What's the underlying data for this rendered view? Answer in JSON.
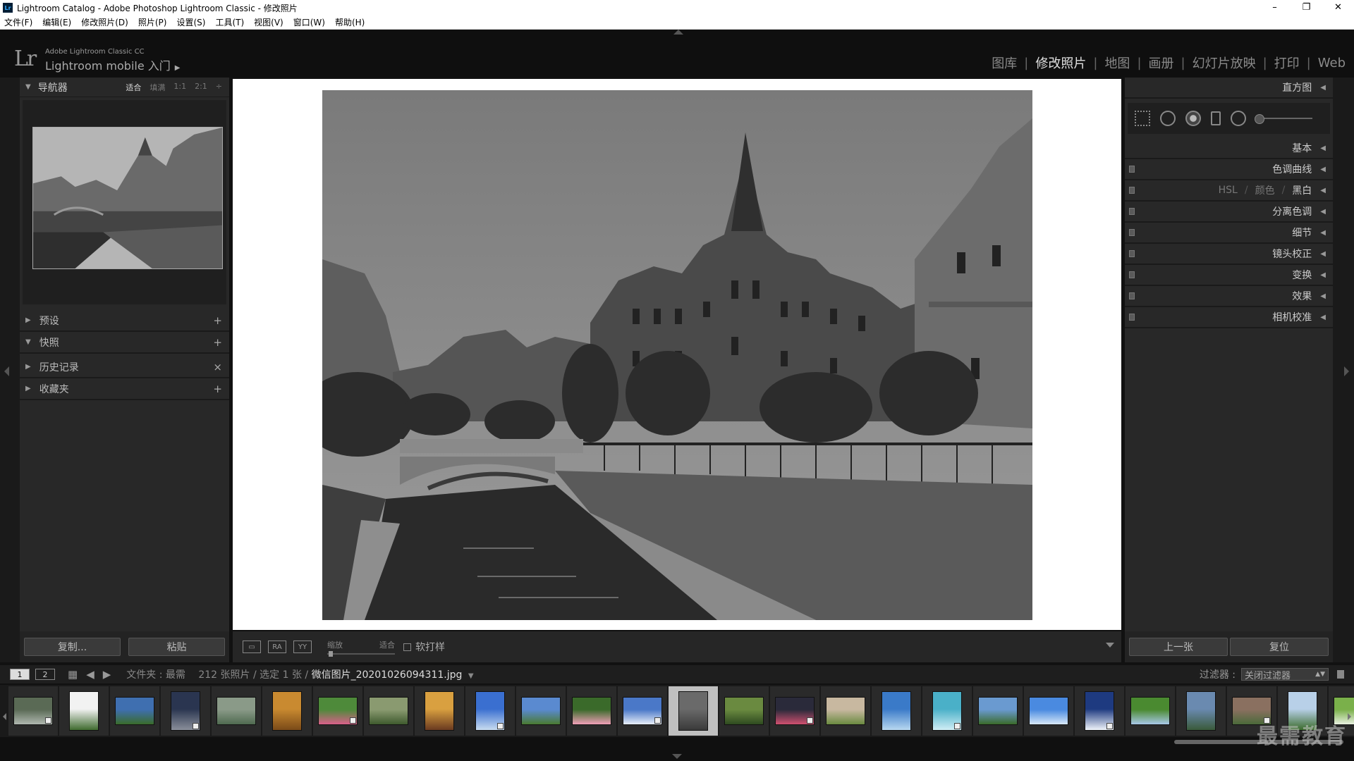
{
  "window": {
    "title": "Lightroom Catalog - Adobe Photoshop Lightroom Classic - 修改照片",
    "controls": [
      "–",
      "❐",
      "✕"
    ]
  },
  "menu": [
    "文件(F)",
    "编辑(E)",
    "修改照片(D)",
    "照片(P)",
    "设置(S)",
    "工具(T)",
    "视图(V)",
    "窗口(W)",
    "帮助(H)"
  ],
  "identity": {
    "logo": "Lr",
    "product": "Adobe Lightroom Classic CC",
    "mobile": "Lightroom mobile 入门",
    "mobile_arrow": "▶"
  },
  "modules": [
    {
      "label": "图库",
      "active": false
    },
    {
      "label": "修改照片",
      "active": true
    },
    {
      "label": "地图",
      "active": false
    },
    {
      "label": "画册",
      "active": false
    },
    {
      "label": "幻灯片放映",
      "active": false
    },
    {
      "label": "打印",
      "active": false
    },
    {
      "label": "Web",
      "active": false
    }
  ],
  "module_separator": "|",
  "left_panel": {
    "navigator": {
      "title": "导航器",
      "zoom_options": [
        "适合",
        "填满",
        "1:1",
        "2:1"
      ],
      "zoom_selected": "适合",
      "zoom_more": "÷"
    },
    "sections": [
      {
        "title": "预设",
        "expanded": false,
        "action": "+"
      },
      {
        "title": "快照",
        "expanded": true,
        "action": "+"
      },
      {
        "title": "历史记录",
        "expanded": false,
        "action": "×"
      },
      {
        "title": "收藏夹",
        "expanded": false,
        "action": "+"
      }
    ],
    "buttons": {
      "copy": "复制...",
      "paste": "粘贴"
    }
  },
  "toolbar": {
    "view_icons": [
      "▭",
      "RA",
      "YY"
    ],
    "zoom_label": "缩放",
    "zoom_value": "适合",
    "zoom_level": 0.02,
    "softproof_label": "软打样",
    "softproof_checked": false
  },
  "right_panel": {
    "histogram_title": "直方图",
    "sections": [
      {
        "title": "基本"
      },
      {
        "title": "色调曲线"
      },
      {
        "hsl": [
          "HSL",
          "颜色",
          "黑白"
        ]
      },
      {
        "title": "分离色调"
      },
      {
        "title": "细节"
      },
      {
        "title": "镜头校正"
      },
      {
        "title": "变换"
      },
      {
        "title": "效果"
      },
      {
        "title": "相机校准"
      }
    ],
    "buttons": {
      "previous": "上一张",
      "reset": "复位"
    }
  },
  "filmstrip_bar": {
    "pages": [
      "1",
      "2"
    ],
    "folder_label": "文件夹 : 最需",
    "count_text": "212 张照片 / 选定 1 张 /",
    "filename": "微信图片_20201026094311.jpg",
    "filter_label": "过滤器 :",
    "filter_value": "关闭过滤器"
  },
  "filmstrip": {
    "selected_index": 13,
    "thumbs": [
      {
        "colors": [
          "#5a6a55",
          "#b0b8b0"
        ]
      },
      {
        "colors": [
          "#f2f2f2",
          "#3f6b2e"
        ]
      },
      {
        "colors": [
          "#3f6fb0",
          "#3a6b2a"
        ]
      },
      {
        "colors": [
          "#2a3550",
          "#8a8f9a"
        ]
      },
      {
        "colors": [
          "#8a9a88",
          "#4f6a50"
        ]
      },
      {
        "colors": [
          "#c98a30",
          "#7a4a18"
        ]
      },
      {
        "colors": [
          "#4e8a3a",
          "#d9608a"
        ]
      },
      {
        "colors": [
          "#8a9a70",
          "#3e5a2e"
        ]
      },
      {
        "colors": [
          "#d9a040",
          "#6a3a20"
        ]
      },
      {
        "colors": [
          "#3a6fd0",
          "#c8dcf0"
        ]
      },
      {
        "colors": [
          "#5a8ad0",
          "#4a7a30"
        ]
      },
      {
        "colors": [
          "#3a6a2a",
          "#f0a0b8"
        ]
      },
      {
        "colors": [
          "#4a78c8",
          "#e8eef8"
        ]
      },
      {
        "colors": [
          "#6a6a6a",
          "#3a3a3a"
        ]
      },
      {
        "colors": [
          "#6a8a40",
          "#2e4a20"
        ]
      },
      {
        "colors": [
          "#2a2a3a",
          "#d05070"
        ]
      },
      {
        "colors": [
          "#c8b8a0",
          "#6a8a40"
        ]
      },
      {
        "colors": [
          "#3a7ac8",
          "#b8d8f0"
        ]
      },
      {
        "colors": [
          "#4ab0c8",
          "#d0eef5"
        ]
      },
      {
        "colors": [
          "#6a9ad0",
          "#3a6a2a"
        ]
      },
      {
        "colors": [
          "#4a8ae0",
          "#d8e8f8"
        ]
      },
      {
        "colors": [
          "#1e3a80",
          "#f0f4fa"
        ]
      },
      {
        "colors": [
          "#4a8a30",
          "#a8c8e8"
        ]
      },
      {
        "colors": [
          "#6a8ab0",
          "#3a5a3a"
        ]
      },
      {
        "colors": [
          "#8a7060",
          "#4a6a3a"
        ]
      },
      {
        "colors": [
          "#b8d0e8",
          "#3a6a2a"
        ]
      },
      {
        "colors": [
          "#7ab04a",
          "#e8f0e0"
        ]
      }
    ]
  },
  "watermark": "最需教育"
}
